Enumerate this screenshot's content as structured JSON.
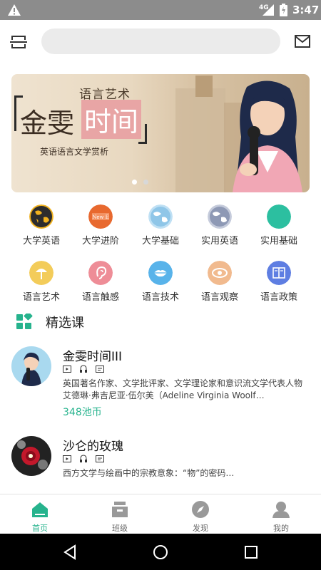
{
  "status_bar": {
    "network": "4G",
    "time": "3:47"
  },
  "search": {
    "placeholder": ""
  },
  "banner": {
    "subtitle": "语言艺术",
    "title_left": "金雯",
    "title_right": "时间",
    "caption": "英语语言文学赏析",
    "page_count": 2,
    "active_index": 0
  },
  "categories": [
    {
      "label": "大学英语",
      "icon": "globe-dark-icon",
      "color": "#2d2d2d"
    },
    {
      "label": "大学进阶",
      "icon": "news-icon",
      "color": "#e8692f"
    },
    {
      "label": "大学基础",
      "icon": "globe-light-icon",
      "color": "#8fc6e8"
    },
    {
      "label": "实用英语",
      "icon": "globe-gray-icon",
      "color": "#8e99b5"
    },
    {
      "label": "实用基础",
      "icon": "circle-teal-icon",
      "color": "#2cbfa0"
    },
    {
      "label": "语言艺术",
      "icon": "art-icon",
      "color": "#f3cc5a"
    },
    {
      "label": "语言触感",
      "icon": "ear-icon",
      "color": "#ee8d97"
    },
    {
      "label": "语言技术",
      "icon": "lips-icon",
      "color": "#58b3ea"
    },
    {
      "label": "语言观察",
      "icon": "eye-icon",
      "color": "#f1ba8e"
    },
    {
      "label": "语言政策",
      "icon": "book-icon",
      "color": "#5e7ee2"
    }
  ],
  "section": {
    "title": "精选课"
  },
  "courses": [
    {
      "title": "金雯时间III",
      "desc": "英国著名作家、文学批评家、文学理论家和意识流文学代表人物艾德琳·弗吉尼亚·伍尔芙（Adeline Virginia Woolf…",
      "price": "348池币"
    },
    {
      "title": "沙仑的玫瑰",
      "desc": "西方文学与绘画中的宗教意象：“物”的密码…",
      "price": ""
    }
  ],
  "bottom_nav": {
    "items": [
      {
        "label": "首页",
        "icon": "home-icon",
        "active": true
      },
      {
        "label": "班级",
        "icon": "class-icon",
        "active": false
      },
      {
        "label": "发现",
        "icon": "compass-icon",
        "active": false
      },
      {
        "label": "我的",
        "icon": "profile-icon",
        "active": false
      }
    ],
    "active_color": "#26b38d",
    "inactive_color": "#666666"
  }
}
